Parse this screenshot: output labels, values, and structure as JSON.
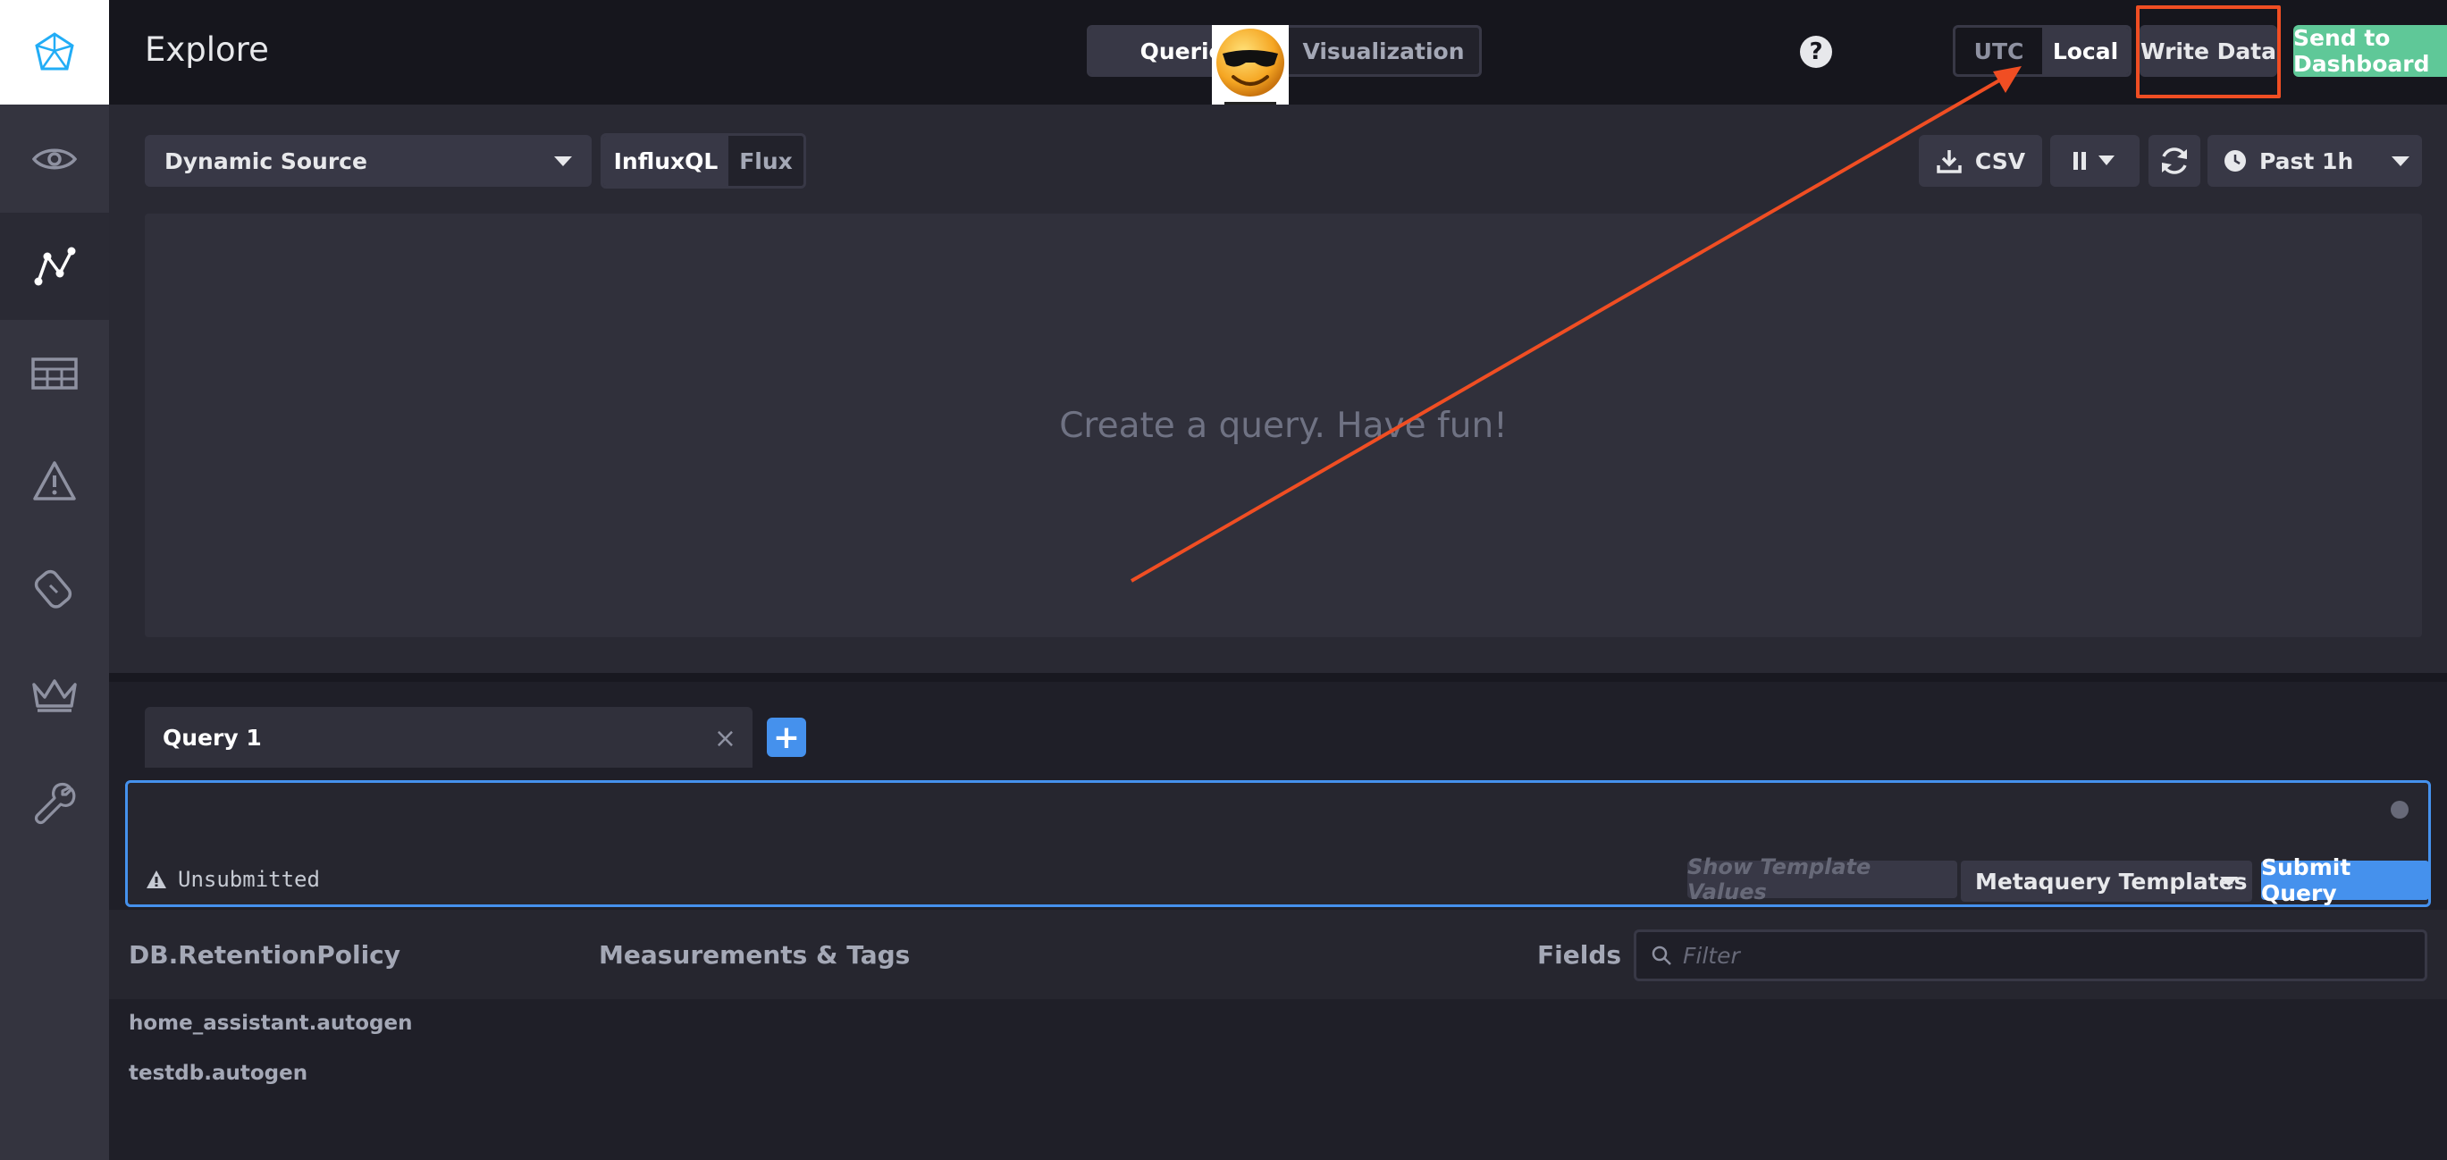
{
  "header": {
    "title": "Explore",
    "mode_tabs": [
      {
        "label": "Queries",
        "active": true
      },
      {
        "label": "Visualization",
        "active": false
      }
    ],
    "help_label": "?",
    "timezone": [
      {
        "label": "UTC",
        "active": false
      },
      {
        "label": "Local",
        "active": true
      }
    ],
    "write_data_label": "Write Data",
    "send_label": "Send to Dashboard"
  },
  "sidebar": {
    "items": [
      {
        "icon": "eye-icon",
        "active": false
      },
      {
        "icon": "graph-icon",
        "active": true
      },
      {
        "icon": "table-icon",
        "active": false
      },
      {
        "icon": "alert-icon",
        "active": false
      },
      {
        "icon": "bandage-icon",
        "active": false
      },
      {
        "icon": "crown-icon",
        "active": false
      },
      {
        "icon": "wrench-icon",
        "active": false
      }
    ]
  },
  "toolbar": {
    "source": "Dynamic Source",
    "languages": [
      {
        "label": "InfluxQL",
        "active": true
      },
      {
        "label": "Flux",
        "active": false
      }
    ],
    "csv_label": "CSV",
    "time_range": "Past 1h"
  },
  "graph": {
    "empty_message": "Create a query. Have fun!"
  },
  "query": {
    "tab_label": "Query 1",
    "close_label": "×",
    "add_label": "+",
    "status": "Unsubmitted",
    "show_template_values": "Show Template Values",
    "metaquery_templates": "Metaquery Templates",
    "submit_label": "Submit Query"
  },
  "schema": {
    "db_title": "DB.RetentionPolicy",
    "measurements_title": "Measurements & Tags",
    "fields_title": "Fields",
    "filter_placeholder": "Filter",
    "databases": [
      "home_assistant.autogen",
      "testdb.autogen"
    ]
  },
  "colors": {
    "accent_blue": "#4591ed",
    "send_green": "#5fc898",
    "annotation_red": "#f04e23"
  }
}
